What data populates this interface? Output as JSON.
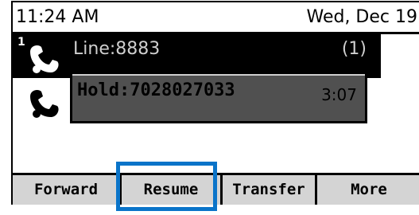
{
  "status_bar": {
    "time": "11:24 AM",
    "date": "Wed, Dec 19"
  },
  "line": {
    "number": "1",
    "label": "Line:8883",
    "count": "(1)"
  },
  "call": {
    "label": "Hold:7028027033",
    "timer": "3:07"
  },
  "softkeys": [
    "Forward",
    "Resume",
    "Transfer",
    "More"
  ],
  "colors": {
    "highlight": "#0a74c9",
    "softkey_bg": "#d4d4d4",
    "call_bg": "#505050"
  },
  "icons": {
    "line": "phone-handset-icon",
    "call": "phone-handset-icon"
  }
}
